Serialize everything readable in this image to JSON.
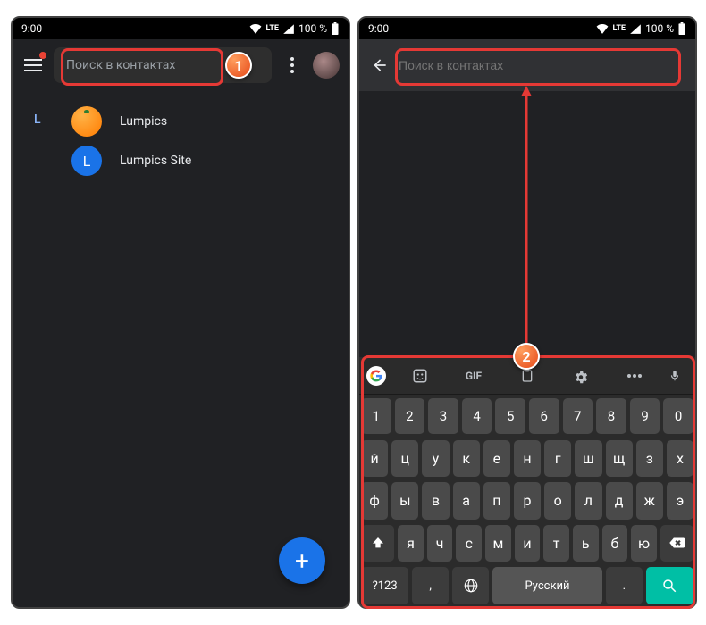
{
  "status": {
    "time": "9:00",
    "lte": "LTE",
    "battery": "100 %"
  },
  "appbar": {
    "search_placeholder": "Поиск в контактах"
  },
  "contacts": {
    "section": "L",
    "items": [
      {
        "name": "Lumpics",
        "initial": ""
      },
      {
        "name": "Lumpics Site",
        "initial": "L"
      }
    ]
  },
  "fab": {
    "label": "+"
  },
  "keyboard": {
    "toolbar": {
      "gif": "GIF"
    },
    "numbers": [
      "1",
      "2",
      "3",
      "4",
      "5",
      "6",
      "7",
      "8",
      "9",
      "0"
    ],
    "row1": [
      "й",
      "ц",
      "у",
      "к",
      "е",
      "н",
      "г",
      "ш",
      "щ",
      "з",
      "х"
    ],
    "row2": [
      "ф",
      "ы",
      "в",
      "а",
      "п",
      "р",
      "о",
      "л",
      "д",
      "ж",
      "э"
    ],
    "row3": [
      "я",
      "ч",
      "с",
      "м",
      "и",
      "т",
      "ь",
      "б",
      "ю"
    ],
    "symbols": "?123",
    "comma": ",",
    "space": "Русский",
    "period": "."
  },
  "annotations": {
    "step1": "1",
    "step2": "2"
  }
}
